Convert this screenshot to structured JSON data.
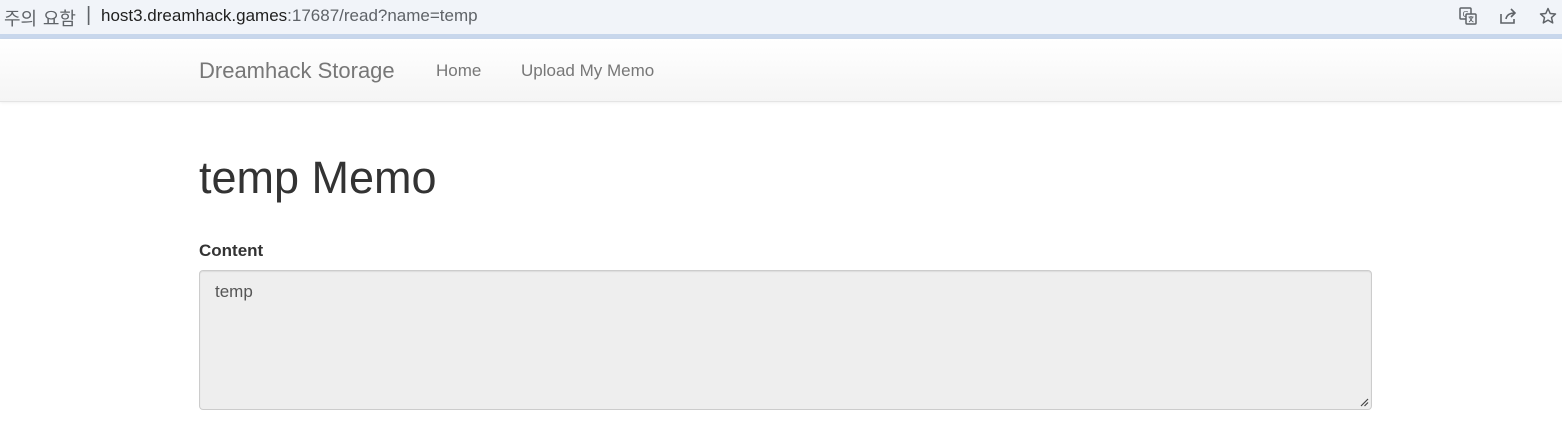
{
  "browser": {
    "security_warning": "주의 요함",
    "separator": "|",
    "url_host": "host3.dreamhack.games",
    "url_path": ":17687/read?name=temp",
    "icons": [
      "translate-icon",
      "share-icon",
      "bookmark-star-icon"
    ]
  },
  "navbar": {
    "brand": "Dreamhack Storage",
    "links": [
      "Home",
      "Upload My Memo"
    ]
  },
  "main": {
    "title": "temp Memo",
    "content_label": "Content",
    "content_value": "temp"
  },
  "colors": {
    "textarea_bg": "#eeeeee",
    "nav_text": "#777777",
    "heading": "#333333"
  }
}
